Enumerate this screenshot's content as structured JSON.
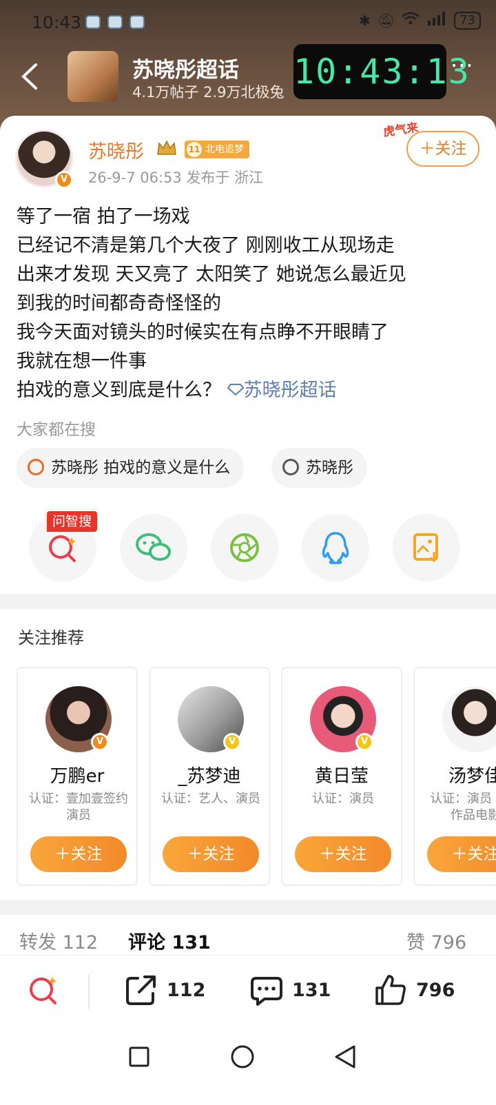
{
  "status_bar": {
    "time": "10:43",
    "battery": "73"
  },
  "topbar": {
    "title": "苏晓彤超话",
    "subtitle": "4.1万帖子 2.9万北极兔",
    "clock": "10:43:13",
    "more": "···"
  },
  "post": {
    "author": "苏晓彤",
    "tag_label": "北电追梦",
    "badge_icon_text": "11",
    "meta": "26-9-7 06:53  发布于 浙江",
    "follow_label": "＋关注",
    "deco_text": "虎气来",
    "lines": [
      "等了一宿 拍了一场戏",
      "已经记不清是第几个大夜了 刚刚收工从现场走",
      "出来才发现 天又亮了 太阳笑了 她说怎么最近见",
      "到我的时间都奇奇怪怪的",
      "我今天面对镜头的时候实在有点睁不开眼睛了",
      "我就在想一件事"
    ],
    "last_line": "拍戏的意义到底是什么？",
    "topic_link": "苏晓彤超话"
  },
  "search": {
    "label": "大家都在搜",
    "chips": [
      "苏晓彤 拍戏的意义是什么",
      "苏晓彤"
    ]
  },
  "share": {
    "ask_label": "问智搜",
    "icons": [
      "ask-search-icon",
      "wechat-icon",
      "moments-icon",
      "qq-icon",
      "save-image-icon"
    ]
  },
  "recommend": {
    "title": "关注推荐",
    "cards": [
      {
        "name": "万鹏er",
        "desc": "认证：壹加壹签约演员",
        "button": "＋关注"
      },
      {
        "name": "_苏梦迪",
        "desc": "认证：艺人、演员",
        "button": "＋关注"
      },
      {
        "name": "黄日莹",
        "desc": "认证：演员",
        "button": "＋关注"
      },
      {
        "name": "汤梦佳",
        "desc": "认证：演员 代表作品电影",
        "button": "＋关注"
      }
    ]
  },
  "stats": {
    "repost_label": "转发",
    "repost_count": "112",
    "comment_label": "评论",
    "comment_count": "131",
    "like_label": "赞",
    "like_count": "796"
  },
  "bottom_bar": {
    "share_count": "112",
    "comment_count": "131",
    "like_count": "796"
  },
  "colors": {
    "accent": "#f3892a",
    "link": "#5b7fb1",
    "header_bg": "#6a5140",
    "clock_digits": "#47e6a9"
  }
}
